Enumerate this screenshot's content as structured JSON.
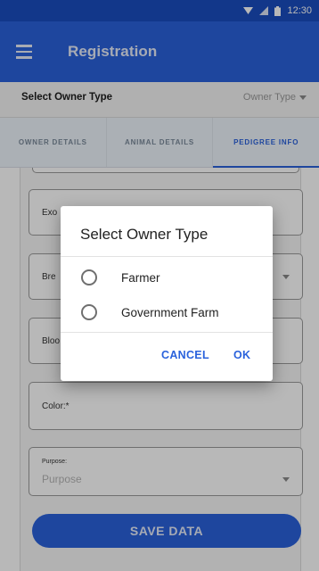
{
  "status_bar": {
    "time": "12:30",
    "icons": [
      "wifi-icon",
      "signal-icon",
      "battery-icon"
    ]
  },
  "app_bar": {
    "title": "Registration",
    "menu_icon": "hamburger-menu-icon"
  },
  "owner": {
    "label": "Select Owner Type",
    "select_placeholder": "Owner Type"
  },
  "tabs": [
    {
      "label": "OWNER DETAILS",
      "active": false
    },
    {
      "label": "ANIMAL DETAILS",
      "active": false
    },
    {
      "label": "PEDIGREE INFO",
      "active": true
    }
  ],
  "form": {
    "exotic_label": "Exo",
    "breed_label": "Bre",
    "blood_label": "Bloo",
    "color_label": "Color:*",
    "purpose_label": "Purpose:",
    "purpose_placeholder": "Purpose",
    "save_label": "SAVE DATA"
  },
  "dialog": {
    "title": "Select Owner Type",
    "options": [
      "Farmer",
      "Government Farm"
    ],
    "cancel_label": "CANCEL",
    "ok_label": "OK"
  },
  "colors": {
    "primary": "#2a62dc",
    "status_bar": "#1a4dbf",
    "tab_bg": "#eef4fb"
  }
}
